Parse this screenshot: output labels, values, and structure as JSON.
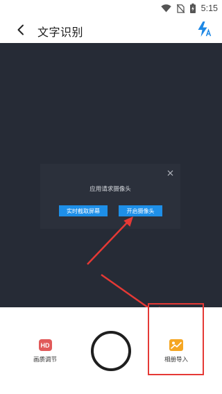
{
  "status_bar": {
    "time": "5:15"
  },
  "app_bar": {
    "title": "文字识别"
  },
  "dialog": {
    "message": "应用请求摄像头",
    "buttons": [
      {
        "label": "实时截取屏幕"
      },
      {
        "label": "开启摄像头"
      }
    ]
  },
  "toolbar": {
    "quality": {
      "icon_text": "HD",
      "label": "画质调节"
    },
    "album": {
      "label": "相册导入"
    }
  },
  "colors": {
    "camera_bg": "#262b36",
    "dialog_bg": "#2b303b",
    "dialog_button": "#1e8fe8",
    "flash_icon": "#1e88e5",
    "hd_icon": "#e15a5a",
    "album_icon": "#f5a623",
    "annotation": "#e53935"
  },
  "icons": [
    "wifi-icon",
    "no-sim-icon",
    "battery-icon",
    "back-icon",
    "flash-auto-icon",
    "close-icon",
    "hd-icon",
    "album-icon"
  ]
}
